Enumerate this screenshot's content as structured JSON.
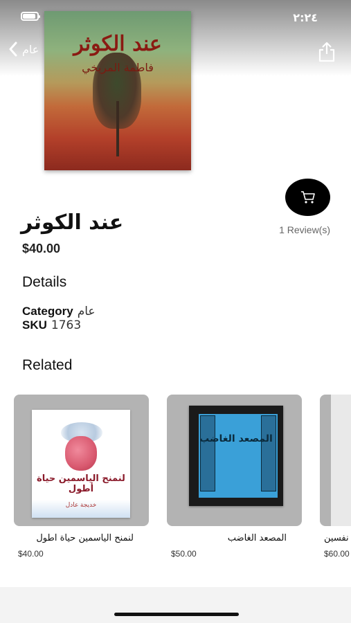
{
  "status_bar": {
    "time": "٢:٢٤"
  },
  "nav": {
    "back_label": "عام",
    "back_icon": "chevron-left-icon",
    "share_icon": "share-icon"
  },
  "cover": {
    "title": "عند الكوثر",
    "author": "فاطمة المريخي"
  },
  "product": {
    "title": "عند الكوثر",
    "price": "$40.00",
    "reviews": "1 Review(s)",
    "cart_icon": "cart-icon"
  },
  "details": {
    "heading": "Details",
    "category_label": "Category",
    "category_value": "عام",
    "sku_label": "SKU",
    "sku_value": "1763"
  },
  "related": {
    "heading": "Related",
    "items": [
      {
        "name": "لنمنح الياسمين حياة اطول",
        "price": "$40.00",
        "cover_title": "لنمنح الياسمين حياة أطول",
        "cover_author": "خديجة عادل"
      },
      {
        "name": "المصعد الغاضب",
        "price": "$50.00",
        "cover_title": "المصعد الغاضب"
      },
      {
        "name": "نفسين",
        "price": "$60.00"
      }
    ]
  },
  "colors": {
    "accent": "#000000",
    "card_bg": "#b3b3b3"
  }
}
